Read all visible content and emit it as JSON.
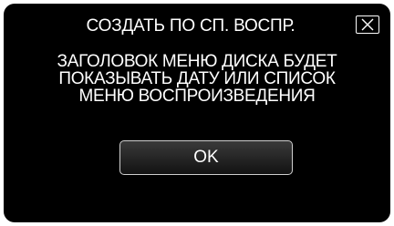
{
  "dialog": {
    "title": "СОЗДАТЬ ПО СП. ВОСПР.",
    "message_lines": [
      "ЗАГОЛОВОК МЕНЮ ДИСКА БУДЕТ",
      "ПОКАЗЫВАТЬ ДАТУ ИЛИ СПИСОК",
      "МЕНЮ ВОСПРОИЗВЕДЕНИЯ"
    ],
    "ok_label": "OK",
    "close_icon": "close-icon"
  },
  "colors": {
    "background": "#000000",
    "text": "#ffffff",
    "button_border": "#cfcfcf"
  }
}
